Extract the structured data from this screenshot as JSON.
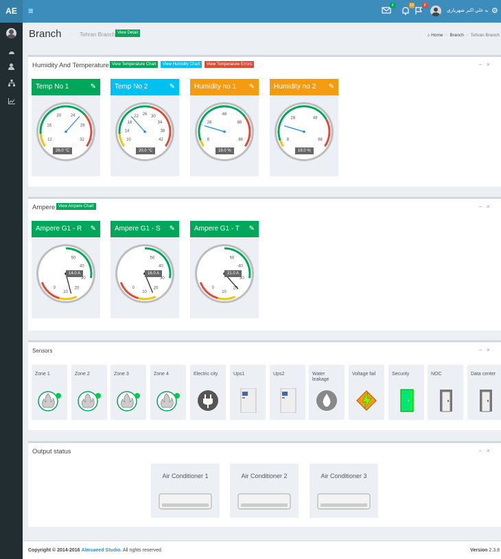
{
  "header": {
    "logo": "AE",
    "menu_toggle": "≡",
    "user_name": "سيد علي اکبر شهرياري",
    "badges": {
      "mail": "4",
      "notifications": "10",
      "flags": "9"
    },
    "colors": {
      "bar": "#3c8dbc",
      "logo_bg": "#367fa9"
    }
  },
  "sidebar": {
    "items": [
      {
        "icon": "dashboard-icon"
      },
      {
        "icon": "user-icon"
      },
      {
        "icon": "sitemap-icon"
      },
      {
        "icon": "line-chart-icon"
      }
    ]
  },
  "page": {
    "title": "Branch",
    "subtitle": "Tehran Branch",
    "view_detail": "View Detail",
    "breadcrumb": [
      "Home",
      "Branch",
      "Tehran Branch"
    ]
  },
  "humidity_box": {
    "title": "Humidity And Temperature",
    "buttons": [
      "View Temperature Chart",
      "View Humidity Chart",
      "View Temperature Errors"
    ],
    "gauges": [
      {
        "label": "Temp No 1",
        "color": "#00a65a",
        "value": 26,
        "display": "26.0 °C",
        "min": 10,
        "max": 34,
        "ticks": [
          "12",
          "16",
          "20",
          "24",
          "28",
          "32"
        ]
      },
      {
        "label": "Temp No 2",
        "color": "#00c0ef",
        "value": 20,
        "display": "20.0 °C",
        "min": 8,
        "max": 44,
        "ticks": [
          "10",
          "14",
          "18",
          "22",
          "26",
          "30",
          "34",
          "38",
          "42"
        ]
      },
      {
        "label": "Humidity no 1",
        "color": "#f39c12",
        "value": 18,
        "display": "18.0 %",
        "min": 4,
        "max": 72,
        "ticks": [
          "8",
          "28",
          "48",
          "68",
          "88"
        ]
      },
      {
        "label": "Humidity no 2",
        "color": "#f39c12",
        "value": 18,
        "display": "18.0 %",
        "min": 4,
        "max": 72,
        "ticks": [
          "8",
          "28",
          "48",
          "68"
        ]
      }
    ]
  },
  "ampere_box": {
    "title": "Ampere",
    "button": "View Ampere Chart",
    "gauges": [
      {
        "label": "Ampere G1 - R",
        "color": "#00a65a",
        "value": 14,
        "display": "14.0 A",
        "ticks": [
          "0",
          "10",
          "20",
          "30",
          "40",
          "50"
        ]
      },
      {
        "label": "Ampere G1 - S",
        "color": "#00a65a",
        "value": 16,
        "display": "16.0 A",
        "ticks": [
          "0",
          "10",
          "20",
          "30",
          "40",
          "50"
        ]
      },
      {
        "label": "Ampere G1 - T",
        "color": "#00a65a",
        "value": 21,
        "display": "21.0 A",
        "ticks": [
          "0",
          "10",
          "20",
          "30",
          "40",
          "50"
        ]
      }
    ]
  },
  "sensors_box": {
    "title": "Sensors",
    "items": [
      {
        "label": "Zone 1",
        "icon": "fire-sensor-icon"
      },
      {
        "label": "Zone 2",
        "icon": "fire-sensor-icon"
      },
      {
        "label": "Zone 3",
        "icon": "fire-sensor-icon"
      },
      {
        "label": "Zone 4",
        "icon": "fire-sensor-icon"
      },
      {
        "label": "Electric city",
        "icon": "power-plug-icon"
      },
      {
        "label": "Ups1",
        "icon": "ups-icon"
      },
      {
        "label": "Ups2",
        "icon": "ups-icon"
      },
      {
        "label": "Water leakage",
        "icon": "water-drop-icon"
      },
      {
        "label": "Voltage fail",
        "icon": "high-voltage-icon"
      },
      {
        "label": "Security",
        "icon": "open-door-icon"
      },
      {
        "label": "NOC",
        "icon": "closed-door-icon"
      },
      {
        "label": "Data center",
        "icon": "closed-door-icon"
      }
    ]
  },
  "output_box": {
    "title": "Output status",
    "items": [
      {
        "label": "Air Conditioner 1",
        "icon": "air-conditioner-icon"
      },
      {
        "label": "Air Conditioner 2",
        "icon": "air-conditioner-icon"
      },
      {
        "label": "Air Conditioner 3",
        "icon": "air-conditioner-icon"
      }
    ]
  },
  "footer": {
    "copyright_prefix": "Copyright © 2014-2016",
    "studio": "Almsaeed Studio.",
    "rights": "All rights reserved.",
    "version_label": "Version",
    "version": "2.3.8"
  }
}
